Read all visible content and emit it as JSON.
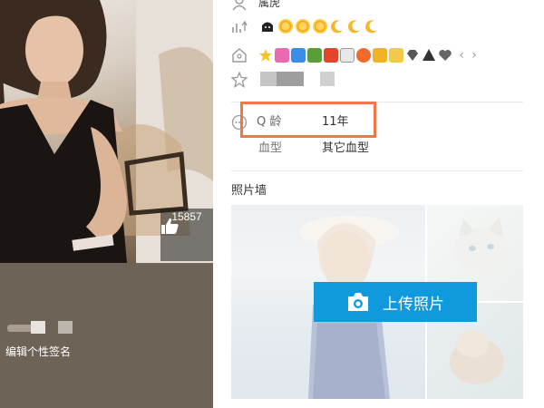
{
  "profile": {
    "like_count": "15857",
    "signature_placeholder": "编辑个性签名"
  },
  "info": {
    "zodiac": "属虎",
    "level_icons": [
      "crown-icon",
      "sun-icon",
      "sun-icon",
      "sun-icon",
      "moon-icon",
      "moon-icon",
      "moon-icon"
    ],
    "badge_icons": [
      "star-badge",
      "fun-app-badge",
      "qq-photo-badge",
      "gift-badge",
      "hongbao-badge",
      "pet-badge",
      "q-game-badge",
      "music-badge",
      "qzone-badge",
      "diamond-badge",
      "svip-badge",
      "heart-badge"
    ],
    "qage_label": "Q 龄",
    "qage_value": "11年",
    "blood_label": "血型",
    "blood_value": "其它血型"
  },
  "photo_wall": {
    "title": "照片墙",
    "upload_label": "上传照片"
  },
  "colors": {
    "highlight_border": "#ef7847",
    "upload_button": "#1199dd",
    "bottom_bar": "#6e6357"
  }
}
